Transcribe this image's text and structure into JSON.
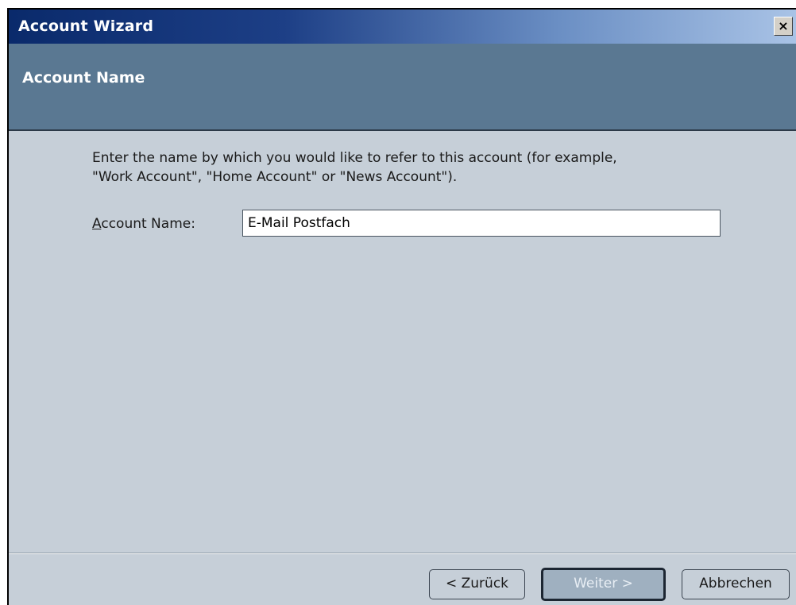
{
  "window": {
    "title": "Account Wizard",
    "close_label": "×"
  },
  "header": {
    "title": "Account Name"
  },
  "content": {
    "description_line1": "Enter the name by which you would like to refer to this account (for example,",
    "description_line2": "\"Work Account\", \"Home Account\" or \"News Account\").",
    "field_label_accesskey": "A",
    "field_label_rest": "ccount Name:",
    "account_name_value": "E-Mail Postfach"
  },
  "buttons": {
    "back_label": "< Zurück",
    "next_label": "Weiter >",
    "cancel_label": "Abbrechen"
  },
  "colors": {
    "title_gradient_start": "#0a2a6b",
    "title_gradient_end": "#a9c3e6",
    "header_band": "#5a7892",
    "window_background": "#c6cfd8"
  }
}
